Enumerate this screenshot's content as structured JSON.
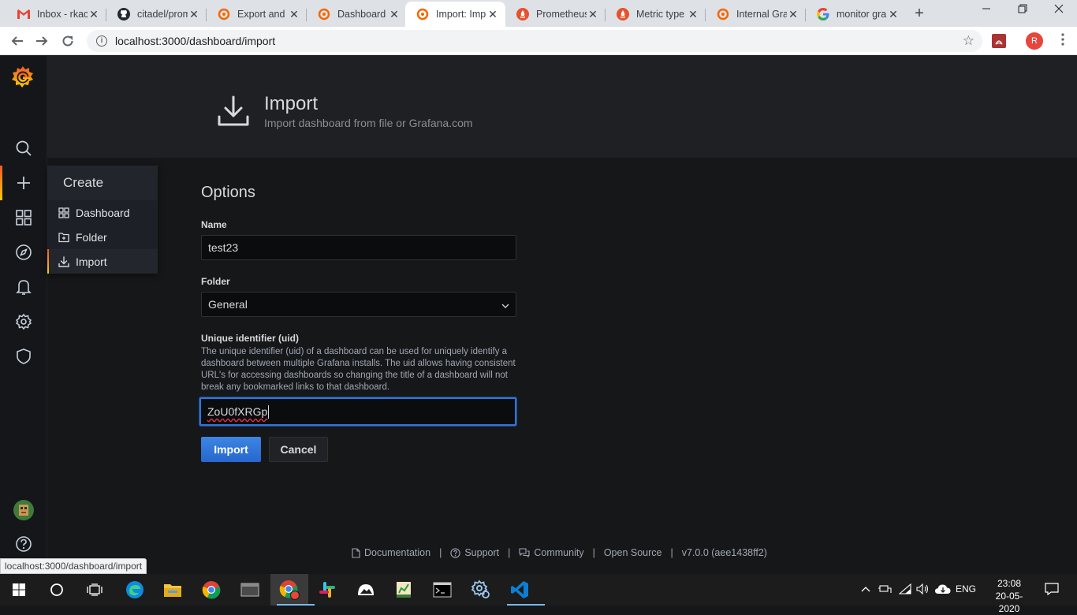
{
  "browser": {
    "tabs": [
      {
        "title": "Inbox - rkac",
        "favicon": "gmail-icon",
        "active": false
      },
      {
        "title": "citadel/prom",
        "favicon": "github-icon",
        "active": false
      },
      {
        "title": "Export and",
        "favicon": "grafana-icon",
        "active": false
      },
      {
        "title": "Dashboard",
        "favicon": "grafana-icon",
        "active": false
      },
      {
        "title": "Import: Imp",
        "favicon": "grafana-icon",
        "active": true
      },
      {
        "title": "Prometheus",
        "favicon": "prometheus-icon",
        "active": false
      },
      {
        "title": "Metric type",
        "favicon": "prometheus-icon",
        "active": false
      },
      {
        "title": "Internal Gra",
        "favicon": "grafana-icon",
        "active": false
      },
      {
        "title": "monitor gra",
        "favicon": "google-icon",
        "active": false
      }
    ],
    "close_glyph": "✕",
    "new_tab_glyph": "+",
    "url": "localhost:3000/dashboard/import",
    "profile_initial": "R",
    "status_url": "localhost:3000/dashboard/import",
    "colors": {
      "tabstrip": "#dee1e6",
      "profile": "#e8453c"
    }
  },
  "sidemenu": {
    "icons": [
      "grafana-logo",
      "search-icon",
      "plus-icon",
      "dashboards-icon",
      "explore-icon",
      "alerting-icon",
      "configuration-icon",
      "shield-icon",
      "avatar",
      "help-icon"
    ]
  },
  "create_menu": {
    "header": "Create",
    "items": [
      {
        "label": "Dashboard",
        "icon": "dashboard-grid-icon"
      },
      {
        "label": "Folder",
        "icon": "folder-plus-icon"
      },
      {
        "label": "Import",
        "icon": "import-icon",
        "active": true
      }
    ]
  },
  "page": {
    "title": "Import",
    "subtitle": "Import dashboard from file or Grafana.com"
  },
  "options": {
    "heading": "Options",
    "name_label": "Name",
    "name_value": "test23",
    "folder_label": "Folder",
    "folder_value": "General",
    "uid_label": "Unique identifier (uid)",
    "uid_description": "The unique identifier (uid) of a dashboard can be used for uniquely identify a dashboard between multiple Grafana installs. The uid allows having consistent URL's for accessing dashboards so changing the title of a dashboard will not break any bookmarked links to that dashboard.",
    "uid_value": "ZoU0fXRGp",
    "import_button": "Import",
    "cancel_button": "Cancel"
  },
  "footer": {
    "documentation": "Documentation",
    "support": "Support",
    "community": "Community",
    "open_source": "Open Source",
    "version": "v7.0.0 (aee1438ff2)",
    "separator": "|"
  },
  "taskbar": {
    "language": "ENG",
    "time": "23:08",
    "date": "20-05-2020"
  },
  "theme": {
    "accent": "#3274d9",
    "brand_gradient": [
      "#f05a28",
      "#fbca0a"
    ],
    "bg": "#161719"
  }
}
